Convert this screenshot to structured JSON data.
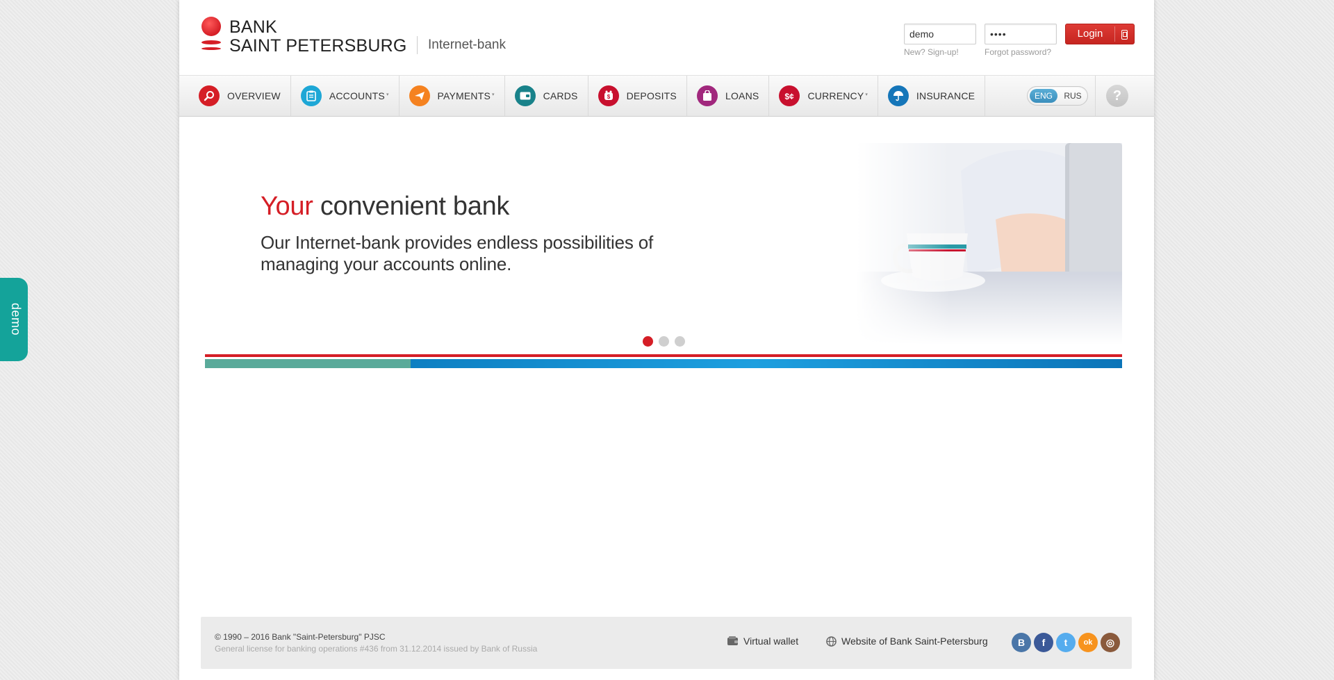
{
  "brand": {
    "name_line1": "BANK",
    "name_line2": "SAINT PETERSBURG",
    "subtitle": "Internet-bank",
    "color": "#d51e26"
  },
  "login": {
    "username_value": "demo",
    "password_value": "••••",
    "button_label": "Login",
    "signup_link": "New? Sign-up!",
    "forgot_link": "Forgot password?"
  },
  "nav": {
    "items": [
      {
        "label": "OVERVIEW",
        "icon": "search-icon",
        "color": "#d51e26",
        "dropdown": false
      },
      {
        "label": "ACCOUNTS",
        "icon": "clipboard-icon",
        "color": "#1ea7d6",
        "dropdown": true
      },
      {
        "label": "PAYMENTS",
        "icon": "paper-plane-icon",
        "color": "#f58220",
        "dropdown": true
      },
      {
        "label": "CARDS",
        "icon": "card-icon",
        "color": "#19828a",
        "dropdown": false
      },
      {
        "label": "DEPOSITS",
        "icon": "piggy-bank-icon",
        "color": "#c8102e",
        "dropdown": false
      },
      {
        "label": "LOANS",
        "icon": "bag-icon",
        "color": "#a1287d",
        "dropdown": false
      },
      {
        "label": "CURRENCY",
        "icon": "currency-icon",
        "color": "#c8102e",
        "dropdown": true
      },
      {
        "label": "INSURANCE",
        "icon": "umbrella-icon",
        "color": "#1576b9",
        "dropdown": false
      }
    ],
    "caret": "▾",
    "lang_active": "ENG",
    "lang_other": "RUS",
    "help": "?"
  },
  "banner": {
    "title_accent": "Your",
    "title_rest": "convenient bank",
    "text": "Our Internet-bank provides endless possibilities of managing your accounts online.",
    "slides": 3,
    "active_slide": 1
  },
  "footer": {
    "copyright": "© 1990 – 2016 Bank \"Saint-Petersburg\" PJSC",
    "license": "General license for banking operations #436 from 31.12.2014 issued by Bank of Russia",
    "wallet_link": "Virtual wallet",
    "site_link": "Website of Bank Saint-Petersburg",
    "socials": [
      {
        "name": "vkontakte",
        "glyph": "B",
        "color": "#4a76a8"
      },
      {
        "name": "facebook",
        "glyph": "f",
        "color": "#3b5998"
      },
      {
        "name": "twitter",
        "glyph": "t",
        "color": "#55acee"
      },
      {
        "name": "odnoklassniki",
        "glyph": "ok",
        "color": "#f7931e"
      },
      {
        "name": "instagram",
        "glyph": "◎",
        "color": "#8a5a3c"
      }
    ]
  },
  "side_tab": {
    "label": "demo",
    "color": "#14a39a"
  }
}
